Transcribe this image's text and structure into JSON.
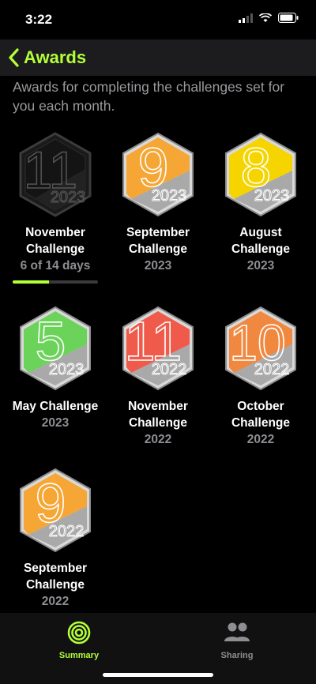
{
  "status_bar": {
    "time": "3:22"
  },
  "nav": {
    "back_label": "Awards"
  },
  "description": "Awards for completing the challenges set for you each month.",
  "colors": {
    "accent": "#b3ff3a"
  },
  "awards": [
    {
      "name": "November Challenge",
      "sub": "6 of 14 days",
      "progress": 0.43,
      "badge_color": "locked",
      "number_glyph": "11",
      "year_glyph": "2023"
    },
    {
      "name": "September Challenge",
      "sub": "2023",
      "badge_color": "#f6a634",
      "number_glyph": "9",
      "year_glyph": "2023"
    },
    {
      "name": "August Challenge",
      "sub": "2023",
      "badge_color": "#f5d400",
      "number_glyph": "8",
      "year_glyph": "2023"
    },
    {
      "name": "May Challenge",
      "sub": "2023",
      "badge_color": "#6bd35a",
      "number_glyph": "5",
      "year_glyph": "2023"
    },
    {
      "name": "November Challenge",
      "sub": "2022",
      "badge_color": "#f05a4a",
      "number_glyph": "11",
      "year_glyph": "2022"
    },
    {
      "name": "October Challenge",
      "sub": "2022",
      "badge_color": "#f08840",
      "number_glyph": "10",
      "year_glyph": "2022"
    },
    {
      "name": "September Challenge",
      "sub": "2022",
      "badge_color": "#f6a634",
      "number_glyph": "9",
      "year_glyph": "2022"
    }
  ],
  "tabs": [
    {
      "label": "Summary",
      "icon": "activity-rings-icon",
      "active": true
    },
    {
      "label": "Sharing",
      "icon": "people-icon",
      "active": false
    }
  ]
}
